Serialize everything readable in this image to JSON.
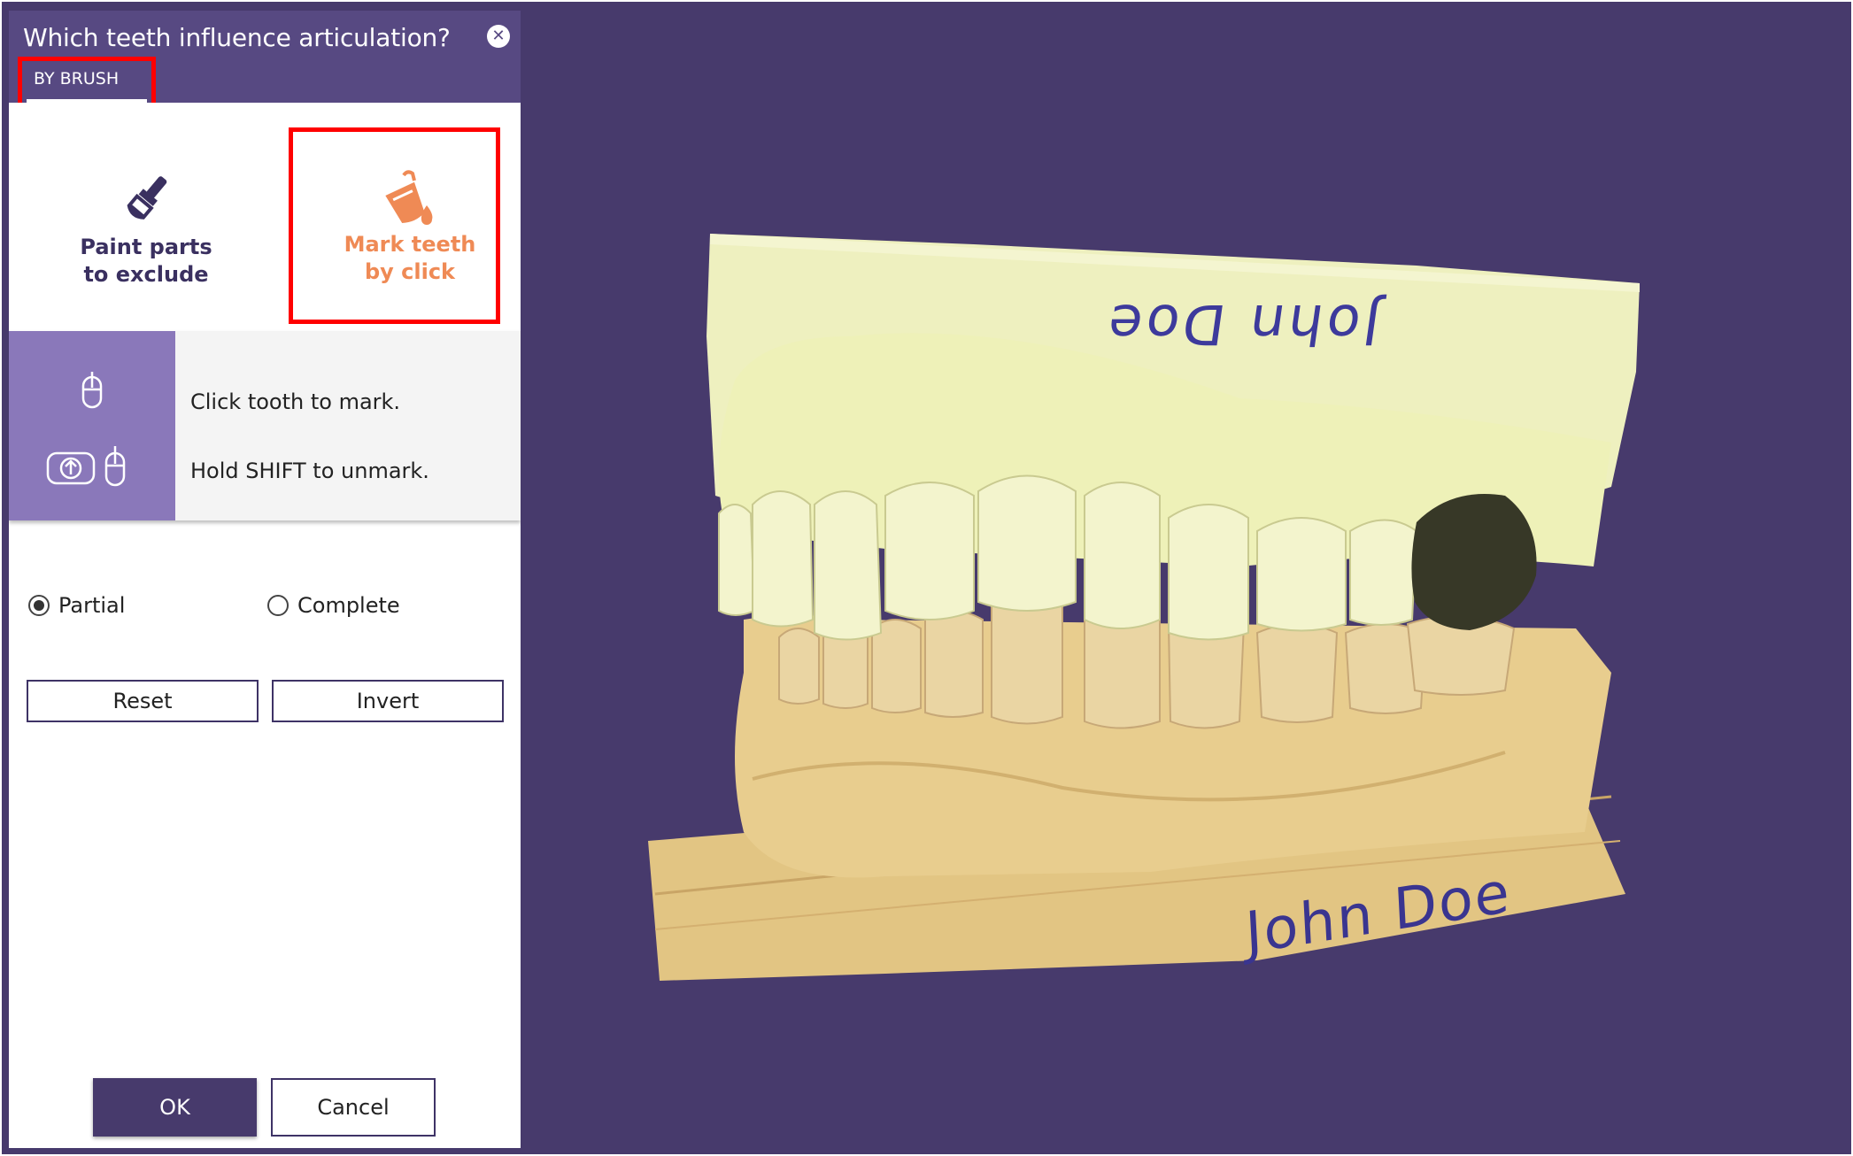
{
  "dialog": {
    "title": "Which teeth influence articulation?",
    "close_icon": "close-icon",
    "mode_tab": "BY BRUSH"
  },
  "tools": {
    "paint": {
      "label_line1": "Paint parts",
      "label_line2": "to exclude",
      "icon": "paint-brush-icon"
    },
    "mark": {
      "label_line1": "Mark teeth",
      "label_line2": "by click",
      "icon": "paint-bucket-icon",
      "color": "#ef8a55"
    }
  },
  "help": {
    "line1": "Click tooth to mark.",
    "line2": "Hold SHIFT to unmark.",
    "icons": [
      "mouse-icon",
      "shift-key-icon",
      "mouse-icon"
    ]
  },
  "options": {
    "selected": "Partial",
    "partial_label": "Partial",
    "complete_label": "Complete"
  },
  "buttons": {
    "reset": "Reset",
    "invert": "Invert",
    "ok": "OK",
    "cancel": "Cancel"
  },
  "scan": {
    "upper_label": "John Doe",
    "lower_label": "John Doe"
  },
  "colors": {
    "header": "#574982",
    "background": "#473a6c",
    "accent": "#ef8a55",
    "help_icon_bg": "#8a78ba",
    "highlight": "#ff0000"
  }
}
